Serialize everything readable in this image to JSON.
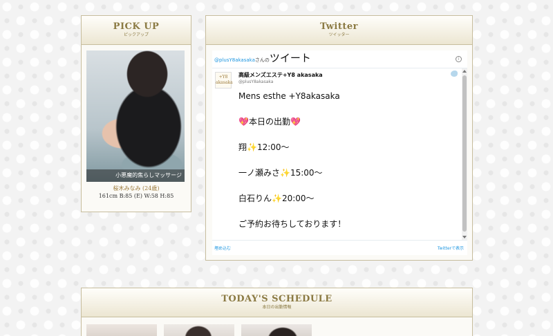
{
  "pickup": {
    "title": "PICK UP",
    "subtitle": "ピックアップ",
    "photo_caption": "小悪魔的焦らしマッサージ",
    "name": "桜木みなみ (24歳)",
    "stats": "161cm  B:85 (E)  W:58  H:85"
  },
  "twitter": {
    "title": "Twitter",
    "subtitle": "ツイッター",
    "handle_link": "@plusY8akasaka",
    "handle_suffix": "さんの",
    "tweets_label": "ツイート",
    "account_name": "高級メンズエステ+Y8 akasaka",
    "account_handle": "@plusY8akasaka",
    "avatar_text": "+Y8 akasaka",
    "tweet_lines": [
      "Mens esthe  +Y8akasaka",
      "",
      "本日の出勤",
      "",
      "翔",
      "",
      "一ノ瀬みさ",
      "",
      "白石りん",
      "",
      "ご予約お待ちしております！"
    ],
    "shift_times": [
      "12:00〜",
      "15:00〜",
      "20:00〜"
    ],
    "heart_emoji": "💖",
    "sparkle_emoji": "✨",
    "embed_label": "埋め込む",
    "view_label": "Twitterで表示"
  },
  "schedule": {
    "title": "TODAY'S SCHEDULE",
    "subtitle": "本日の出勤情報"
  }
}
